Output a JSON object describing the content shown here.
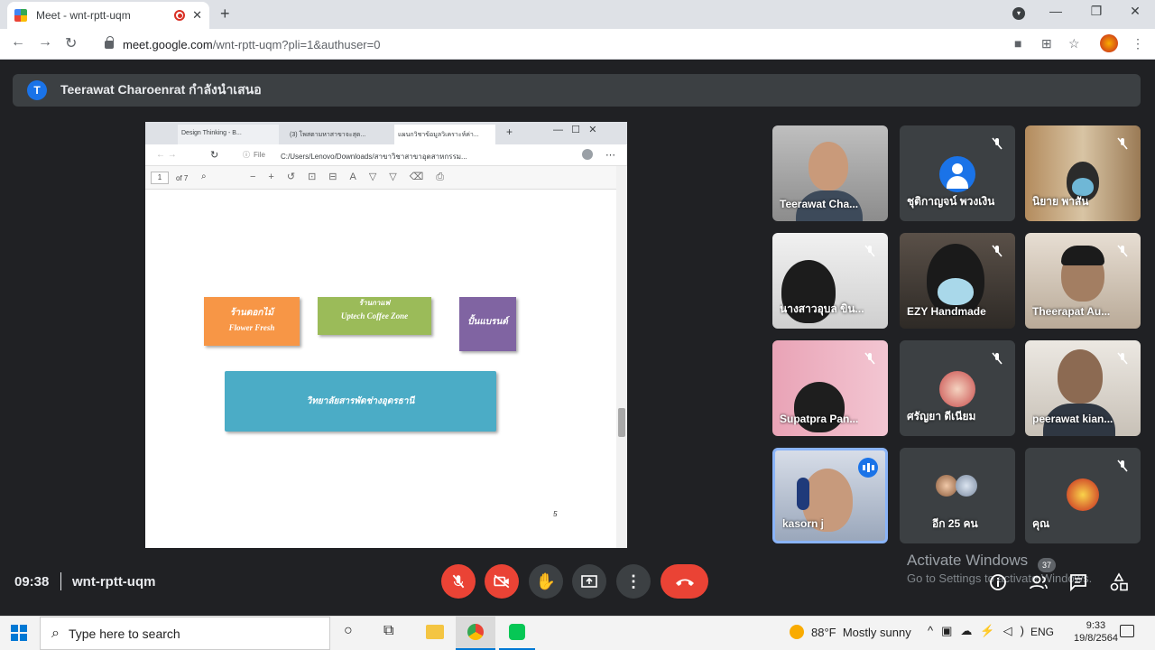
{
  "browser": {
    "tab_title": "Meet - wnt-rptt-uqm",
    "tab_close": "✕",
    "new_tab": "+",
    "url_host": "meet.google.com",
    "url_path": "/wnt-rptt-uqm?pli=1&authuser=0",
    "window_controls": [
      "—",
      "❐",
      "✕"
    ]
  },
  "presenter": {
    "avatar_letter": "T",
    "text": "Teerawat Charoenrat กำลังนำเสนอ"
  },
  "shared_screen": {
    "tabs": [
      "Design Thinking - B...",
      "(3) โพสตามหาสาขาจะสุด...",
      "แผนกวิชาข้อมูลวิเคราะห์ค่า..."
    ],
    "url_label": "File",
    "url": "C:/Users/Lenovo/Downloads/สาขาวิชาสาขาอุตสาหกรรม...",
    "page_box": "1",
    "page_of": "of 7",
    "page_number": "5",
    "boxes": [
      {
        "line1": "ร้านดอกไม้",
        "line2": "Flower Fresh",
        "color": "#f79646"
      },
      {
        "line1": "ร้านกาแฟ",
        "line2": "Uptech Coffee Zone",
        "color": "#9bbb59"
      },
      {
        "line1": "ปั้นแบรนด์",
        "line2": "",
        "color": "#8064a2"
      },
      {
        "line1": "วิทยาลัยสารพัดช่างอุดรธานี",
        "line2": "",
        "color": "#4bacc6"
      }
    ]
  },
  "participants": [
    {
      "name": "Teerawat Cha...",
      "muted": false
    },
    {
      "name": "ชุติกาญจน์ พวงเงิน",
      "muted": true
    },
    {
      "name": "นิยาย พาสัน",
      "muted": true
    },
    {
      "name": "นางสาวอุบล ขิน...",
      "muted": true
    },
    {
      "name": "EZY Handmade",
      "muted": true
    },
    {
      "name": "Theerapat Au...",
      "muted": true
    },
    {
      "name": "Supatpra Pan...",
      "muted": true
    },
    {
      "name": "ศรัญยา ดีเนียม",
      "muted": true
    },
    {
      "name": "peerawat kian...",
      "muted": true
    },
    {
      "name": "kasorn j",
      "muted": false
    },
    {
      "name": "อีก 25 คน",
      "muted": false
    },
    {
      "name": "คุณ",
      "muted": true
    }
  ],
  "meeting": {
    "time": "09:38",
    "code": "wnt-rptt-uqm",
    "people_count": "37"
  },
  "watermark": {
    "line1": "Activate Windows",
    "line2": "Go to Settings to activate Windows."
  },
  "taskbar": {
    "search_placeholder": "Type here to search",
    "weather_temp": "88°F",
    "weather_text": "Mostly sunny",
    "lang": "ENG",
    "time": "9:33",
    "date": "19/8/2564"
  }
}
